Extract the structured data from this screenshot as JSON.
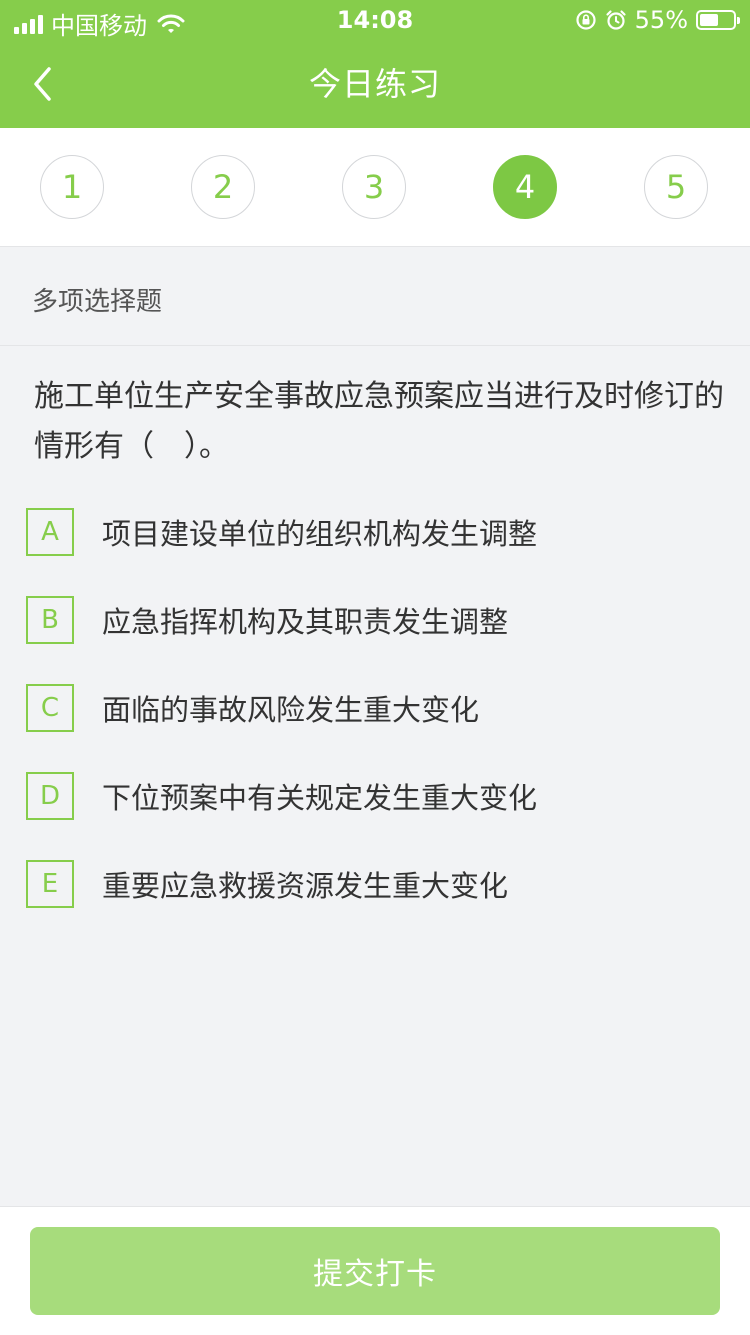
{
  "status_bar": {
    "carrier": "中国移动",
    "time": "14:08",
    "battery_percent_label": "55%",
    "battery_level": 0.55,
    "icons": [
      "signal-icon",
      "wifi-icon",
      "rotation-lock-icon",
      "alarm-icon",
      "battery-icon"
    ]
  },
  "header": {
    "title": "今日练习",
    "back_icon": "chevron-left-icon"
  },
  "stepper": {
    "steps": [
      "1",
      "2",
      "3",
      "4",
      "5"
    ],
    "active_step": "4"
  },
  "question": {
    "type": "多项选择题",
    "text": "施工单位生产安全事故应急预案应当进行及时修订的情形有（　）。",
    "options": [
      {
        "letter": "A",
        "text": "项目建设单位的组织机构发生调整"
      },
      {
        "letter": "B",
        "text": "应急指挥机构及其职责发生调整"
      },
      {
        "letter": "C",
        "text": "面临的事故风险发生重大变化"
      },
      {
        "letter": "D",
        "text": "下位预案中有关规定发生重大变化"
      },
      {
        "letter": "E",
        "text": "重要应急救援资源发生重大变化"
      }
    ]
  },
  "footer": {
    "submit_label": "提交打卡"
  },
  "colors": {
    "brand": "#86cd4b",
    "active_step": "#7dc844",
    "submit_disabled": "#a7dc7c",
    "background": "#f2f3f5"
  }
}
